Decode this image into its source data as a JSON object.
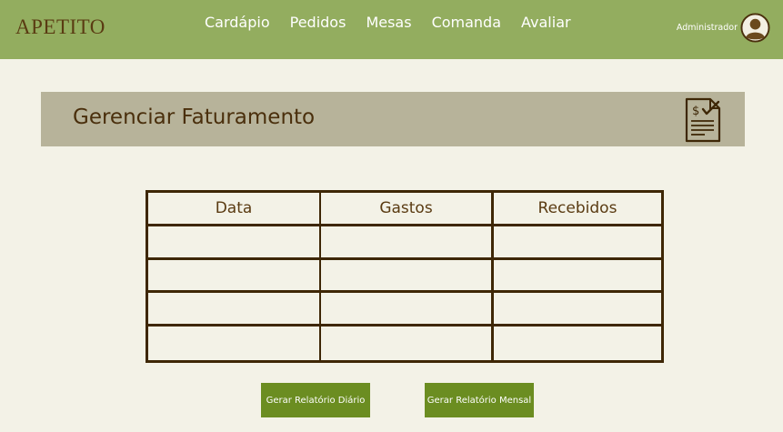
{
  "brand": {
    "name": "APETITO"
  },
  "nav": {
    "items": [
      {
        "label": "Cardápio"
      },
      {
        "label": "Pedidos"
      },
      {
        "label": "Mesas"
      },
      {
        "label": "Comanda"
      },
      {
        "label": "Avaliar"
      }
    ]
  },
  "user": {
    "name": "Administrador",
    "icon": "user-avatar-icon"
  },
  "page": {
    "title": "Gerenciar Faturamento",
    "icon": "invoice-icon"
  },
  "table": {
    "headers": [
      "Data",
      "Gastos",
      "Recebidos"
    ],
    "rows": [
      [
        "",
        "",
        ""
      ],
      [
        "",
        "",
        ""
      ],
      [
        "",
        "",
        ""
      ],
      [
        "",
        "",
        ""
      ]
    ]
  },
  "actions": {
    "daily_report": "Gerar Relatório Diário",
    "monthly_report": "Gerar Relatório Mensal"
  },
  "colors": {
    "topbar": "#93ad5f",
    "background": "#f3f2e7",
    "header_band": "#b7b39a",
    "brand_text": "#5a3b12",
    "table_border": "#3e2706",
    "button": "#6b8d21"
  }
}
